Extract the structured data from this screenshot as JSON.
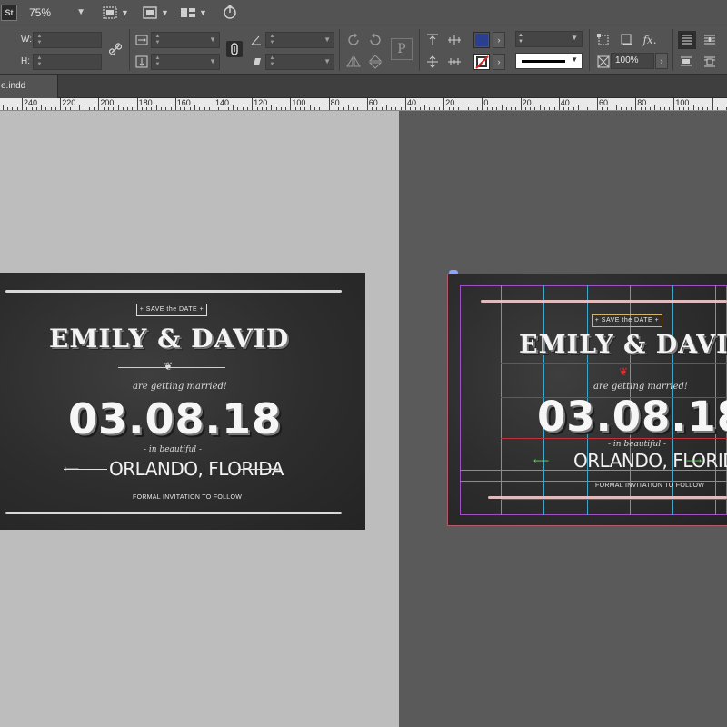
{
  "app": {
    "logo": "St",
    "zoom": "75%"
  },
  "control": {
    "w_label": "W:",
    "h_label": "H:",
    "opacity": "100%",
    "fill_color": "#2a3f8f",
    "stroke_color": "#ffffff",
    "icons": {
      "constrain": "link-icon",
      "rotate_cw": "rotate-cw-icon",
      "rotate_ccw": "rotate-ccw-icon",
      "flip_h": "flip-horizontal-icon",
      "flip_v": "flip-vertical-icon",
      "p_icon": "paragraph-p-icon",
      "fx": "fx-icon"
    }
  },
  "tab": {
    "filename": "e.indd"
  },
  "ruler": {
    "labels": [
      "240",
      "220",
      "200",
      "180",
      "160",
      "140",
      "120",
      "100",
      "80",
      "60",
      "40",
      "20",
      "0",
      "20",
      "40",
      "60",
      "80",
      "100"
    ]
  },
  "invitation": {
    "save_the_date": "+ SAVE the DATE +",
    "names": "EMILY & DAVID",
    "getting_married": "are getting married!",
    "date": "03.08.18",
    "in_beautiful": "- in beautiful -",
    "location": "ORLANDO, FLORIDA",
    "formal": "FORMAL INVITATION TO FOLLOW"
  }
}
